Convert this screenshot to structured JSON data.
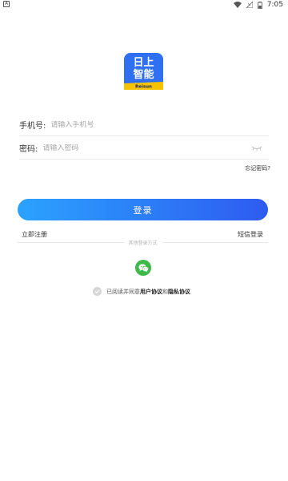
{
  "status_bar": {
    "notification_icon": "A",
    "time": "7:05",
    "icons": [
      "wifi-icon",
      "sim-no-signal-icon",
      "battery-icon"
    ]
  },
  "logo": {
    "line1": "日上",
    "line2": "智能",
    "brand": "Reisun",
    "colors": {
      "background": "#2f6ff2",
      "ribbon": "#f6c300"
    }
  },
  "form": {
    "phone": {
      "label": "手机号:",
      "placeholder": "请输入手机号",
      "value": ""
    },
    "password": {
      "label": "密码:",
      "placeholder": "请输入密码",
      "value": ""
    },
    "forgot_password": "忘记密码?"
  },
  "login_button": {
    "label": "登录"
  },
  "links": {
    "register": "立即注册",
    "sms_login": "短信登录"
  },
  "other_login": {
    "label": "其他登录方式",
    "wechat_icon": "wechat-icon"
  },
  "agreement": {
    "checked": true,
    "prefix": "已阅读并同意",
    "user_agreement": "用户协议",
    "conjunction": "和",
    "privacy_policy": "隐私协议"
  },
  "colors": {
    "accent_start": "#2ba2ff",
    "accent_end": "#2e5bf0",
    "wechat": "#40b94a"
  }
}
